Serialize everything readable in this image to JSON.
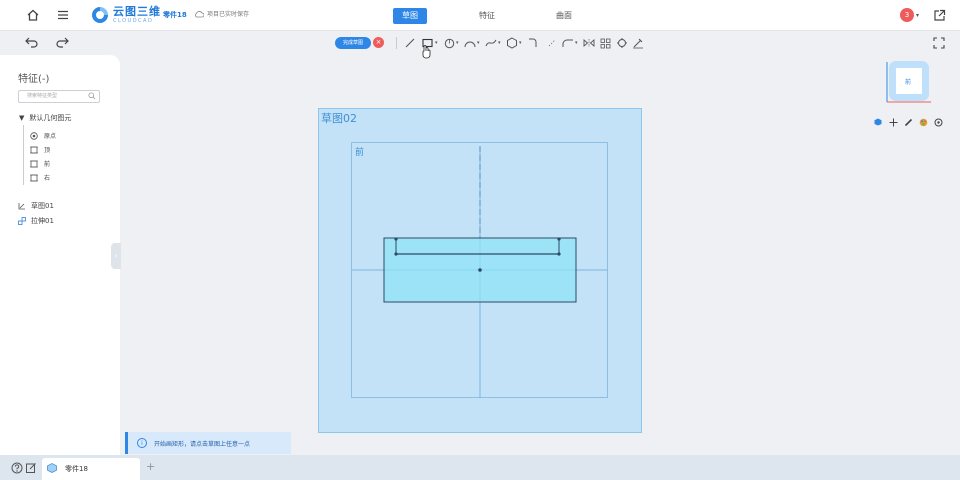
{
  "app": {
    "logo_cn": "云图三维",
    "logo_en": "CLOUDCAD",
    "part_name": "零件18",
    "save_status": "项目已实时保存"
  },
  "mode_tabs": [
    {
      "label": "草图",
      "active": true
    },
    {
      "label": "特征",
      "active": false
    },
    {
      "label": "曲面",
      "active": false
    }
  ],
  "notifications": {
    "count": "3"
  },
  "sketch_toolbar": {
    "finish_label": "完成草图",
    "cancel_symbol": "×",
    "tools": [
      "line-tool",
      "rectangle-tool",
      "circle-tool",
      "arc-tool",
      "spline-tool",
      "polygon-tool",
      "offset-tool",
      "point-tool",
      "fillet-tool",
      "mirror-tool",
      "pattern-tool",
      "constraint-tool",
      "dimension-tool"
    ]
  },
  "left_panel": {
    "title": "特征(-)",
    "search_placeholder": "搜索特征类型",
    "tree_root": "默认几何图元",
    "tree_items": [
      "原点",
      "顶",
      "前",
      "右"
    ],
    "features": [
      "草图01",
      "拉伸01"
    ]
  },
  "canvas": {
    "sketch_plane_label": "草图02",
    "front_plane_label": "前"
  },
  "viewcube": {
    "face_label": "前"
  },
  "hint": {
    "text": "开始画矩形，请点击草图上任意一点"
  },
  "bottom": {
    "doc_tab_label": "零件18",
    "add_tab_symbol": "+"
  },
  "colors": {
    "accent": "#2e87e6",
    "sketch_plane": "#c4e2f7",
    "sketch_shape": "#8fe3f7",
    "danger": "#ef5b5b"
  }
}
